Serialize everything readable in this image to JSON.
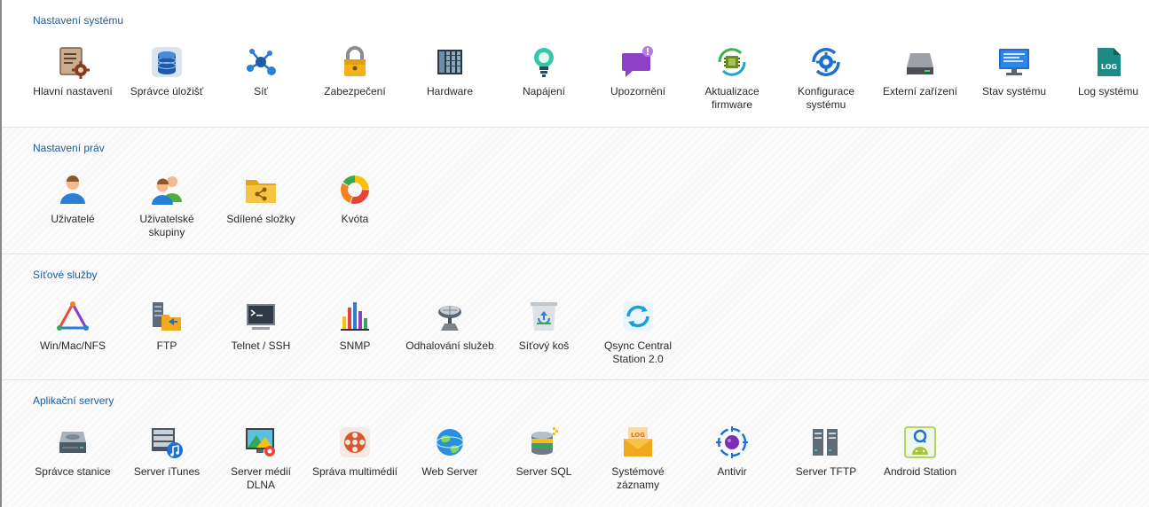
{
  "sections": [
    {
      "title": "Nastavení systému",
      "items": [
        {
          "label": "Hlavní nastavení",
          "icon": "settings-document-gear-icon"
        },
        {
          "label": "Správce úložišť",
          "icon": "storage-database-icon"
        },
        {
          "label": "Síť",
          "icon": "network-icon"
        },
        {
          "label": "Zabezpečení",
          "icon": "padlock-icon"
        },
        {
          "label": "Hardware",
          "icon": "hardware-chassis-icon"
        },
        {
          "label": "Napájení",
          "icon": "power-lightbulb-icon"
        },
        {
          "label": "Upozornění",
          "icon": "notification-bubble-icon"
        },
        {
          "label": "Aktualizace firmware",
          "icon": "firmware-update-chip-icon"
        },
        {
          "label": "Konfigurace systému",
          "icon": "system-config-gear-icon"
        },
        {
          "label": "Externí zařízení",
          "icon": "external-drive-icon"
        },
        {
          "label": "Stav systému",
          "icon": "system-status-monitor-icon"
        },
        {
          "label": "Log systému",
          "icon": "system-log-file-icon"
        }
      ]
    },
    {
      "title": "Nastavení práv",
      "items": [
        {
          "label": "Uživatelé",
          "icon": "user-icon"
        },
        {
          "label": "Uživatelské skupiny",
          "icon": "user-group-icon"
        },
        {
          "label": "Sdílené složky",
          "icon": "shared-folder-icon"
        },
        {
          "label": "Kvóta",
          "icon": "quota-ring-chart-icon"
        }
      ]
    },
    {
      "title": "Síťové služby",
      "items": [
        {
          "label": "Win/Mac/NFS",
          "icon": "win-mac-nfs-triangle-icon"
        },
        {
          "label": "FTP",
          "icon": "ftp-server-folder-icon"
        },
        {
          "label": "Telnet / SSH",
          "icon": "terminal-icon"
        },
        {
          "label": "SNMP",
          "icon": "snmp-bar-chart-icon"
        },
        {
          "label": "Odhalování služeb",
          "icon": "service-discovery-satellite-icon"
        },
        {
          "label": "Síťový koš",
          "icon": "network-recycle-bin-icon"
        },
        {
          "label": "Qsync Central Station 2.0",
          "icon": "qsync-sync-icon"
        }
      ]
    },
    {
      "title": "Aplikační servery",
      "items": [
        {
          "label": "Správce stanice",
          "icon": "station-manager-drive-icon"
        },
        {
          "label": "Server iTunes",
          "icon": "itunes-server-icon"
        },
        {
          "label": "Server médií DLNA",
          "icon": "dlna-media-server-icon"
        },
        {
          "label": "Správa multimédií",
          "icon": "multimedia-film-reel-icon"
        },
        {
          "label": "Web Server",
          "icon": "web-server-globe-icon"
        },
        {
          "label": "Server SQL",
          "icon": "sql-server-database-icon"
        },
        {
          "label": "Systémové záznamy",
          "icon": "system-logs-envelope-icon"
        },
        {
          "label": "Antivir",
          "icon": "antivirus-target-icon"
        },
        {
          "label": "Server TFTP",
          "icon": "tftp-server-icon"
        },
        {
          "label": "Android Station",
          "icon": "android-station-icon"
        }
      ]
    }
  ],
  "colors": {
    "section_title": "#1a5fa0",
    "label_text": "#2a2a2a",
    "divider": "#e4e4e4"
  }
}
